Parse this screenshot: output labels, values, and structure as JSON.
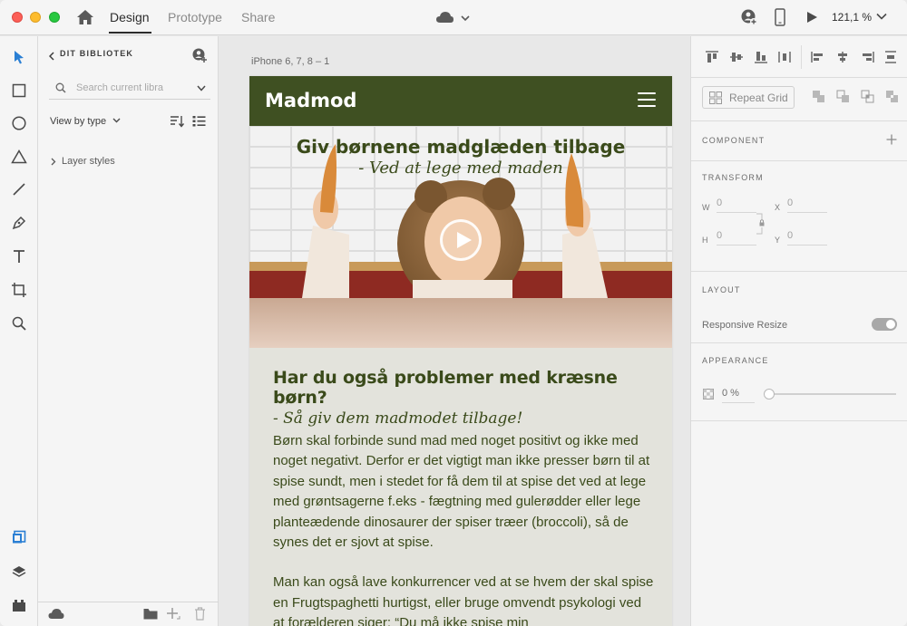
{
  "titlebar": {
    "tabs": [
      {
        "label": "Design",
        "active": true
      },
      {
        "label": "Prototype",
        "active": false
      },
      {
        "label": "Share",
        "active": false
      }
    ],
    "zoom": "121,1 %"
  },
  "library": {
    "title": "DIT BIBLIOTEK",
    "search_placeholder": "Search current libra",
    "view_by": "View by type",
    "layer_styles": "Layer styles"
  },
  "canvas": {
    "artboard_label": "iPhone 6, 7, 8 – 1",
    "site": {
      "logo": "Madmod",
      "hero_line1": "Giv børnene madglæden tilbage",
      "hero_line2": "- Ved at lege med maden",
      "heading": "Har du også problemer med kræsne børn?",
      "subheading": "- Så giv dem madmodet tilbage!",
      "paragraph1": "Børn skal forbinde sund mad med noget positivt og ikke med noget negativt. Derfor er det vigtigt man ikke presser børn til at spise sundt, men i stedet for få dem til at spise det ved at lege med grøntsagerne f.eks - fægtning med gulerødder eller lege planteædende dinosaurer der spiser træer (broccoli), så de synes det er sjovt at spise.",
      "paragraph2": "Man kan også lave konkurrencer ved at se hvem der skal spise en Frugtspaghetti hurtigst, eller bruge omvendt psykologi ved at forælderen siger: “Du må ikke spise min"
    }
  },
  "properties": {
    "repeat_grid": "Repeat Grid",
    "component": "COMPONENT",
    "transform": "TRANSFORM",
    "w_label": "W",
    "w_value": "0",
    "h_label": "H",
    "h_value": "0",
    "x_label": "X",
    "x_value": "0",
    "y_label": "Y",
    "y_value": "0",
    "layout": "LAYOUT",
    "responsive_resize": "Responsive Resize",
    "responsive_resize_on": true,
    "appearance": "APPEARANCE",
    "opacity": "0 %"
  },
  "colors": {
    "site_header": "#3f5022",
    "site_text": "#3a4a1a",
    "accent_blue": "#2a7fd4"
  }
}
